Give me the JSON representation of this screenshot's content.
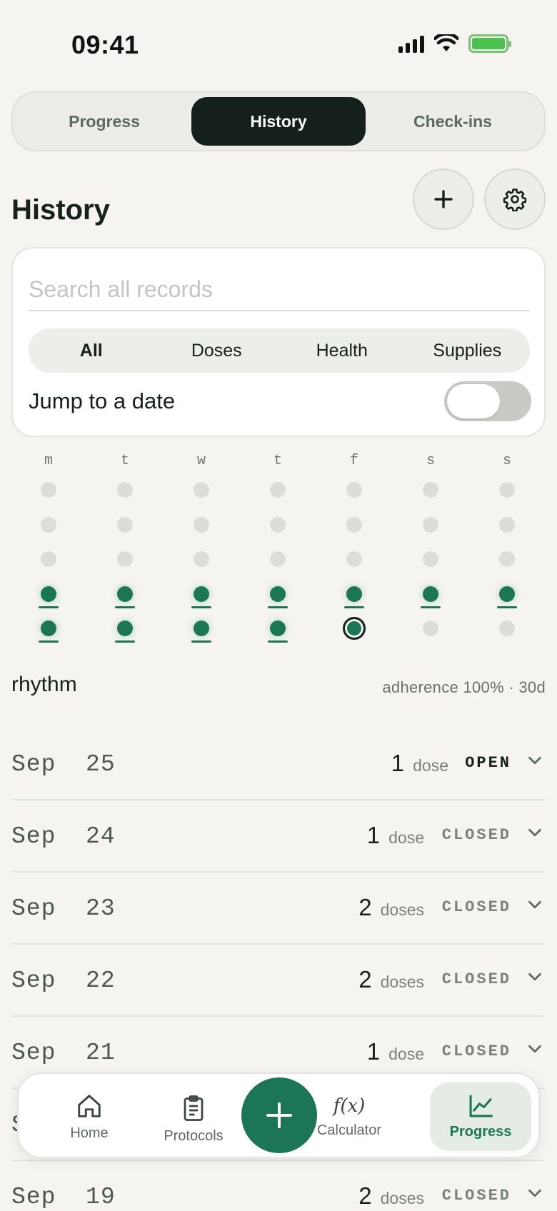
{
  "status_bar": {
    "time": "09:41"
  },
  "tabs": [
    {
      "label": "Progress",
      "active": false
    },
    {
      "label": "History",
      "active": true
    },
    {
      "label": "Check-ins",
      "active": false
    }
  ],
  "header": {
    "title": "History",
    "add_icon": "plus-icon",
    "settings_icon": "gear-icon"
  },
  "search": {
    "placeholder": "Search all records",
    "value": "",
    "filters": [
      {
        "label": "All",
        "active": true
      },
      {
        "label": "Doses",
        "active": false
      },
      {
        "label": "Health",
        "active": false
      },
      {
        "label": "Supplies",
        "active": false
      }
    ],
    "jump_label": "Jump to a date",
    "jump_enabled": false
  },
  "rhythm": {
    "day_labels": [
      "m",
      "t",
      "w",
      "t",
      "f",
      "s",
      "s"
    ],
    "weeks": [
      [
        "empty",
        "empty",
        "empty",
        "empty",
        "empty",
        "empty",
        "empty"
      ],
      [
        "empty",
        "empty",
        "empty",
        "empty",
        "empty",
        "empty",
        "empty"
      ],
      [
        "empty",
        "empty",
        "empty",
        "empty",
        "empty",
        "empty",
        "empty"
      ],
      [
        "filled",
        "filled",
        "filled",
        "filled",
        "filled",
        "filled",
        "filled"
      ],
      [
        "filled",
        "filled",
        "filled",
        "filled",
        "today",
        "empty",
        "empty"
      ]
    ],
    "title": "rhythm",
    "summary": "adherence 100% · 30d"
  },
  "history": [
    {
      "date": "Sep  25",
      "count": "1",
      "unit": "dose",
      "status": "OPEN"
    },
    {
      "date": "Sep  24",
      "count": "1",
      "unit": "dose",
      "status": "CLOSED"
    },
    {
      "date": "Sep  23",
      "count": "2",
      "unit": "doses",
      "status": "CLOSED"
    },
    {
      "date": "Sep  22",
      "count": "2",
      "unit": "doses",
      "status": "CLOSED"
    },
    {
      "date": "Sep  21",
      "count": "1",
      "unit": "dose",
      "status": "CLOSED"
    },
    {
      "date": "Sep  20",
      "count": "",
      "unit": "",
      "status": ""
    },
    {
      "date": "Sep  19",
      "count": "2",
      "unit": "doses",
      "status": "CLOSED"
    }
  ],
  "nav": {
    "items": [
      {
        "label": "Home",
        "icon": "home-icon"
      },
      {
        "label": "Protocols",
        "icon": "clipboard-icon"
      },
      {
        "label": "Calculator",
        "icon": "function-icon",
        "icon_text": "f(x)"
      },
      {
        "label": "Progress",
        "icon": "chart-icon",
        "active": true
      }
    ],
    "fab_icon": "plus-icon"
  }
}
